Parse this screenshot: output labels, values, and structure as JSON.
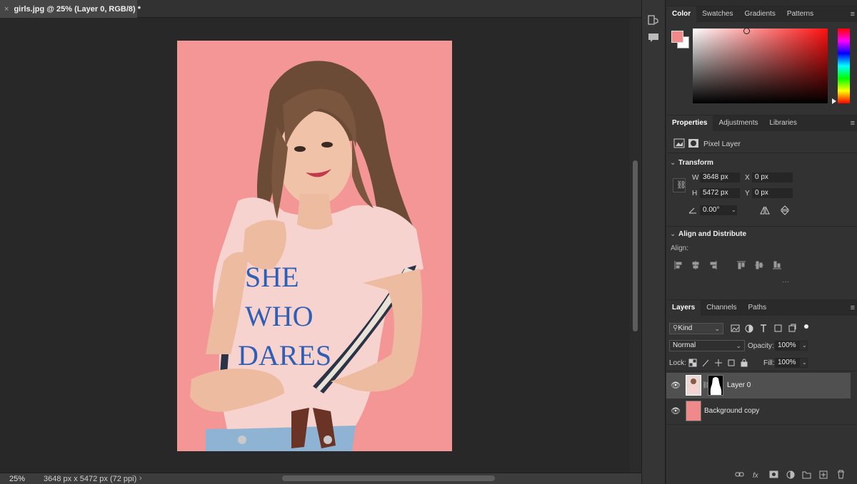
{
  "document": {
    "tab_close": "×",
    "tab_title": "girls.jpg @ 25% (Layer 0, RGB/8) *"
  },
  "status": {
    "zoom": "25%",
    "dimensions": "3648 px x 5472 px (72 ppi)",
    "arrow": "›"
  },
  "shirt_text": [
    "SHE",
    "WHO",
    "DARES"
  ],
  "colors": {
    "foreground": "#f08a8a",
    "background": "#ffffff",
    "canvas_bg": "#f49696"
  },
  "color_panel": {
    "tabs": [
      "Color",
      "Swatches",
      "Gradients",
      "Patterns"
    ]
  },
  "properties_panel": {
    "tabs": [
      "Properties",
      "Adjustments",
      "Libraries"
    ],
    "layer_type": "Pixel Layer",
    "transform": {
      "title": "Transform",
      "w_label": "W",
      "w_value": "3648 px",
      "h_label": "H",
      "h_value": "5472 px",
      "x_label": "X",
      "x_value": "0 px",
      "y_label": "Y",
      "y_value": "0 px",
      "angle_value": "0.00°"
    },
    "align": {
      "title": "Align and Distribute",
      "label": "Align:",
      "more": "···"
    }
  },
  "layers_panel": {
    "tabs": [
      "Layers",
      "Channels",
      "Paths"
    ],
    "filter_kind": "Kind",
    "blend_mode": "Normal",
    "opacity_label": "Opacity:",
    "opacity_value": "100%",
    "lock_label": "Lock:",
    "fill_label": "Fill:",
    "fill_value": "100%",
    "layers": [
      {
        "name": "Layer 0",
        "visible": true,
        "selected": true
      },
      {
        "name": "Background copy",
        "visible": true,
        "selected": false
      }
    ]
  }
}
